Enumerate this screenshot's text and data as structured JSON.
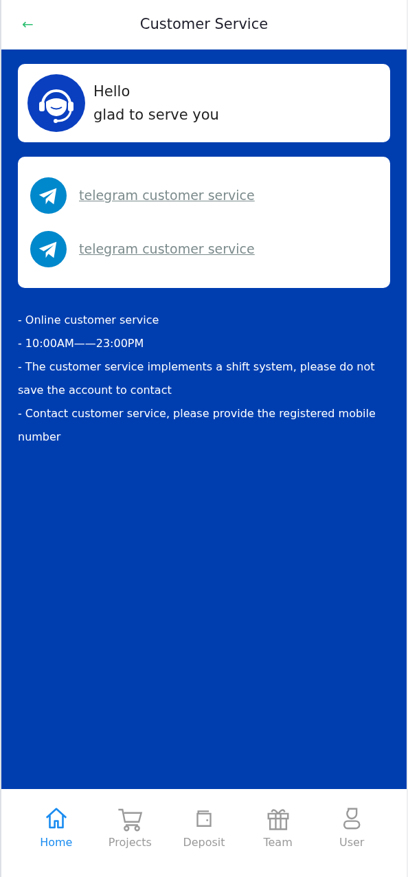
{
  "header": {
    "back": "←",
    "title": "Customer Service"
  },
  "greeting": {
    "lines": [
      "Hello",
      "glad to serve you"
    ]
  },
  "contacts": [
    {
      "label": "telegram customer service"
    },
    {
      "label": "telegram customer service"
    }
  ],
  "notes": [
    "- Online customer service",
    "- 10:00AM——23:00PM",
    "- The customer service implements a shift system, please do not save the account to contact",
    "- Contact customer service, please provide the registered mobile number"
  ],
  "tabs": [
    {
      "label": "Home",
      "kind": "home",
      "selected": true
    },
    {
      "label": "Projects",
      "kind": "cart",
      "selected": false
    },
    {
      "label": "Deposit",
      "kind": "wallet",
      "selected": false
    },
    {
      "label": "Team",
      "kind": "gift",
      "selected": false
    },
    {
      "label": "User",
      "kind": "user",
      "selected": false
    }
  ]
}
